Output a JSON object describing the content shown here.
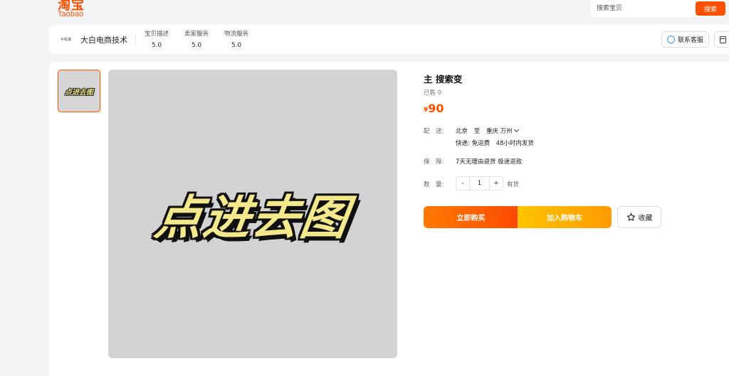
{
  "header": {
    "logo_cn": "淘宝",
    "logo_en": "Taobao",
    "search_placeholder": "搜索宝贝",
    "search_button": "搜索"
  },
  "shop": {
    "logo_text": "手机端",
    "name": "大白电商技术",
    "ratings": [
      {
        "label": "宝贝描述",
        "value": "5.0"
      },
      {
        "label": "卖家服务",
        "value": "5.0"
      },
      {
        "label": "物流服务",
        "value": "5.0"
      }
    ],
    "contact_label": "联系客服"
  },
  "gallery": {
    "thumb_text": "点进去图",
    "main_text": "点进去图"
  },
  "product": {
    "title": "主 搜索变",
    "sold": "已售 0",
    "currency": "¥",
    "price": "90",
    "shipping_label": "配　送:",
    "ship_from": "北京",
    "ship_to_word": "至",
    "ship_to": "重庆 万州",
    "shipping_info": "快递: 免运费　48小时内发货",
    "guarantee_label": "保　障:",
    "guarantee_info": "7天无理由退货 极速退款",
    "quantity_label": "数　量:",
    "quantity_minus": "-",
    "quantity": "1",
    "quantity_plus": "+",
    "stock": "有货",
    "buy_now": "立即购买",
    "add_to_cart": "加入购物车",
    "favorite": "收藏"
  }
}
